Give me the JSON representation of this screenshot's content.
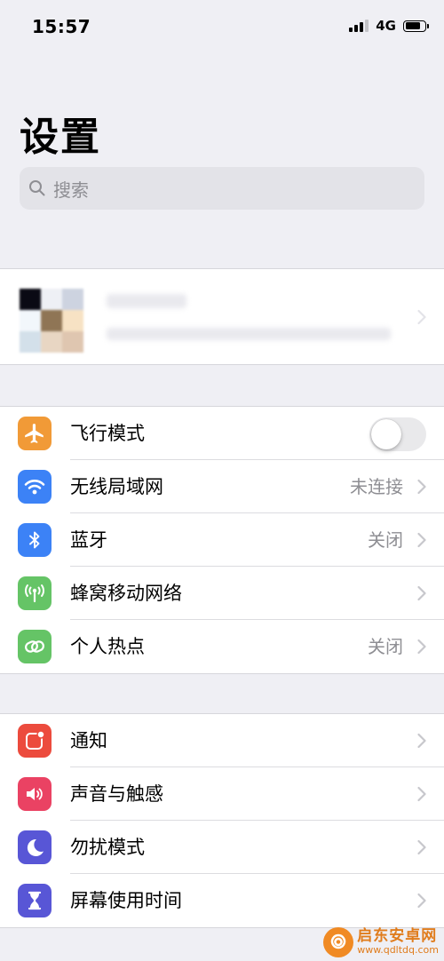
{
  "status_bar": {
    "time": "15:57",
    "network": "4G",
    "signal_bars": 4,
    "signal_active": 3,
    "battery_level": 0.8
  },
  "page": {
    "title": "设置"
  },
  "search": {
    "placeholder": "搜索"
  },
  "groups": [
    {
      "id": "connectivity",
      "items": [
        {
          "name": "airplane",
          "label": "飞行模式",
          "value": "",
          "icon": "airplane-icon",
          "icon_color": "#f19a37",
          "toggle": true,
          "toggle_on": false
        },
        {
          "name": "wifi",
          "label": "无线局域网",
          "value": "未连接",
          "icon": "wifi-icon",
          "icon_color": "#3c82f6"
        },
        {
          "name": "bluetooth",
          "label": "蓝牙",
          "value": "关闭",
          "icon": "bluetooth-icon",
          "icon_color": "#3c82f6"
        },
        {
          "name": "cellular",
          "label": "蜂窝移动网络",
          "value": "",
          "icon": "antenna-icon",
          "icon_color": "#65c466"
        },
        {
          "name": "hotspot",
          "label": "个人热点",
          "value": "关闭",
          "icon": "link-icon",
          "icon_color": "#65c466"
        }
      ]
    },
    {
      "id": "system",
      "items": [
        {
          "name": "notifications",
          "label": "通知",
          "value": "",
          "icon": "notification-icon",
          "icon_color": "#ec4b3d"
        },
        {
          "name": "sounds",
          "label": "声音与触感",
          "value": "",
          "icon": "speaker-icon",
          "icon_color": "#ea4263"
        },
        {
          "name": "dnd",
          "label": "勿扰模式",
          "value": "",
          "icon": "moon-icon",
          "icon_color": "#5856d6"
        },
        {
          "name": "screen-time",
          "label": "屏幕使用时间",
          "value": "",
          "icon": "hourglass-icon",
          "icon_color": "#5856d6"
        }
      ]
    }
  ],
  "watermark": {
    "title": "启东安卓网",
    "url": "www.qdltdq.com"
  }
}
